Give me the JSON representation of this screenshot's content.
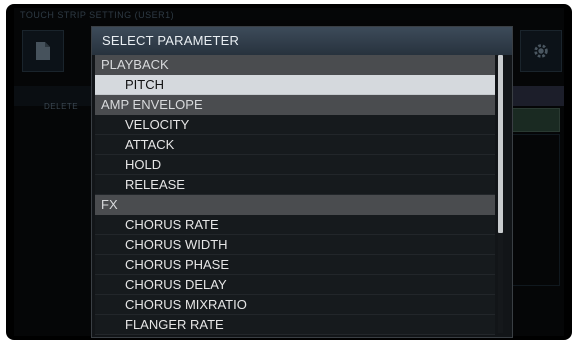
{
  "background": {
    "title": "TOUCH STRIP SETTING (USER1)",
    "delete_label": "DELETE"
  },
  "dialog": {
    "title": "SELECT PARAMETER",
    "scroll_position": 0.0,
    "visible_fraction": 0.64
  },
  "list": [
    {
      "type": "header",
      "label": "PLAYBACK"
    },
    {
      "type": "item",
      "label": "PITCH",
      "selected": true
    },
    {
      "type": "header",
      "label": "AMP ENVELOPE"
    },
    {
      "type": "item",
      "label": "VELOCITY"
    },
    {
      "type": "item",
      "label": "ATTACK"
    },
    {
      "type": "item",
      "label": "HOLD"
    },
    {
      "type": "item",
      "label": "RELEASE"
    },
    {
      "type": "header",
      "label": "FX"
    },
    {
      "type": "item",
      "label": "CHORUS RATE"
    },
    {
      "type": "item",
      "label": "CHORUS WIDTH"
    },
    {
      "type": "item",
      "label": "CHORUS PHASE"
    },
    {
      "type": "item",
      "label": "CHORUS DELAY"
    },
    {
      "type": "item",
      "label": "CHORUS MIXRATIO"
    },
    {
      "type": "item",
      "label": "FLANGER RATE"
    }
  ],
  "colors": {
    "title_bar": "#34424f",
    "section_header": "#4a4c4f",
    "selected_row": "#d5d9dd",
    "row": "#161a1d"
  }
}
